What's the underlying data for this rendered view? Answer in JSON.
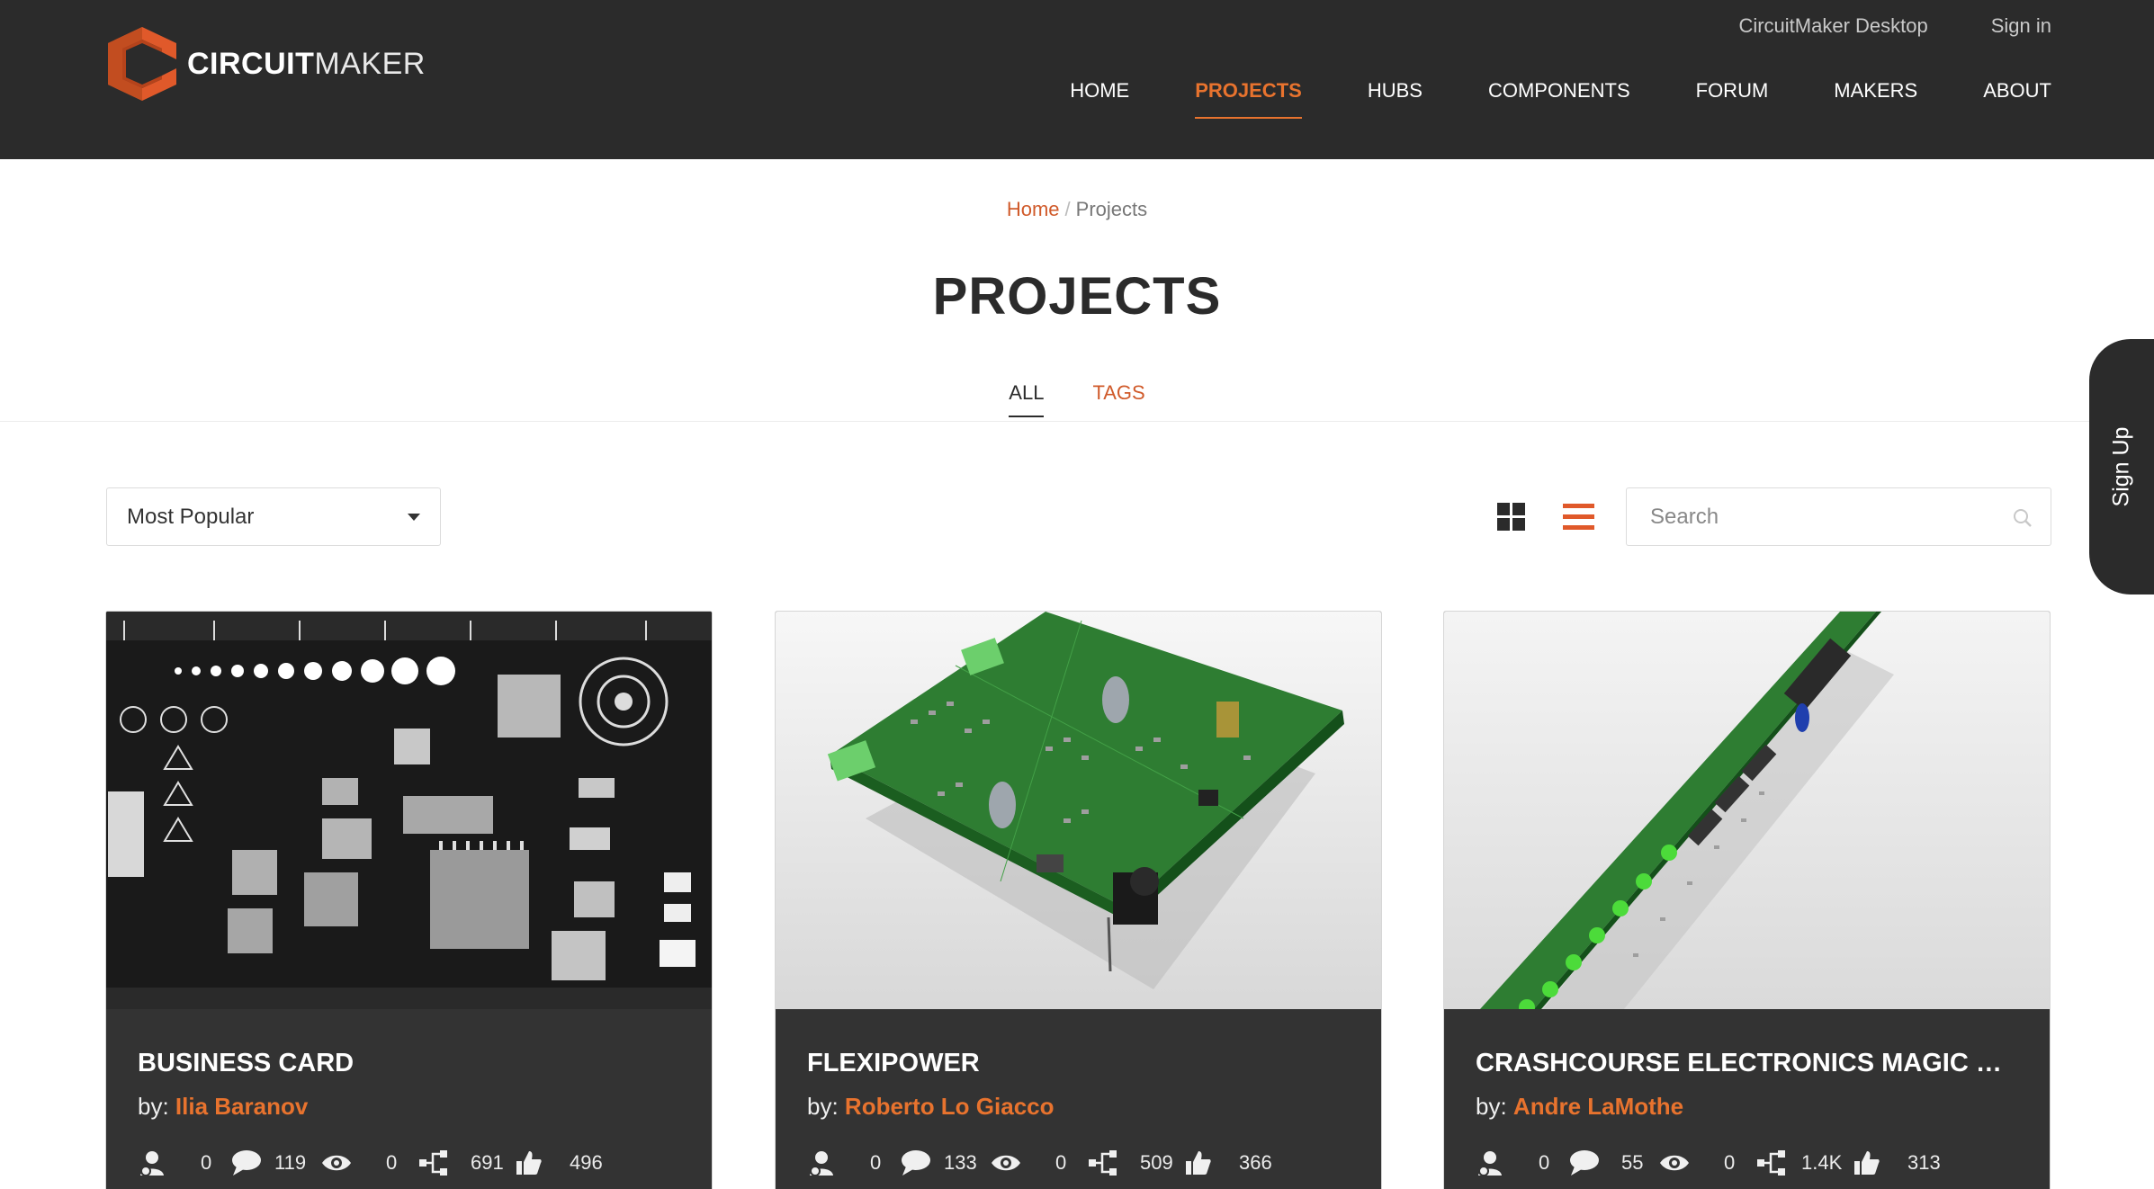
{
  "brand": {
    "bold": "CIRCUIT",
    "light": "MAKER"
  },
  "top_links": [
    {
      "label": "CircuitMaker Desktop"
    },
    {
      "label": "Sign in"
    }
  ],
  "nav": [
    {
      "label": "HOME"
    },
    {
      "label": "PROJECTS",
      "active": true
    },
    {
      "label": "HUBS"
    },
    {
      "label": "COMPONENTS"
    },
    {
      "label": "FORUM"
    },
    {
      "label": "MAKERS"
    },
    {
      "label": "ABOUT"
    }
  ],
  "breadcrumb": {
    "home": "Home",
    "separator": "/",
    "current": "Projects"
  },
  "page_title": "PROJECTS",
  "tabs": [
    {
      "label": "ALL",
      "active": true
    },
    {
      "label": "TAGS"
    }
  ],
  "signup_label": "Sign Up",
  "sort": {
    "selected": "Most Popular"
  },
  "search": {
    "placeholder": "Search",
    "value": ""
  },
  "colors": {
    "accent": "#e8732e",
    "header_bg": "#2b2b2b",
    "card_bg": "#333333",
    "link": "#d05a2a"
  },
  "cards": [
    {
      "title": "BUSINESS CARD",
      "by": "by:",
      "author": "Ilia Baranov",
      "stats": {
        "forks_user": "0",
        "comments": "119",
        "views": "0",
        "components": "691",
        "likes": "496"
      }
    },
    {
      "title": "FLEXIPOWER",
      "by": "by:",
      "author": "Roberto Lo Giacco",
      "stats": {
        "forks_user": "0",
        "comments": "133",
        "views": "0",
        "components": "509",
        "likes": "366"
      }
    },
    {
      "title": "CRASHCOURSE ELECTRONICS MAGIC W...",
      "by": "by:",
      "author": "Andre LaMothe",
      "stats": {
        "forks_user": "0",
        "comments": "55",
        "views": "0",
        "components": "1.4K",
        "likes": "313"
      }
    }
  ]
}
